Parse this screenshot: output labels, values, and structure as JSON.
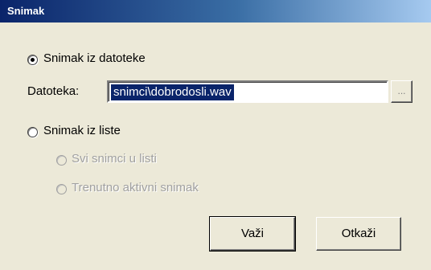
{
  "window": {
    "title": "Snimak"
  },
  "options": {
    "from_file": {
      "label": "Snimak iz datoteke",
      "selected": true
    },
    "from_list": {
      "label": "Snimak iz liste",
      "selected": false
    },
    "all_in_list": {
      "label": "Svi snimci u listi",
      "enabled": false
    },
    "currently_active": {
      "label": "Trenutno aktivni snimak",
      "enabled": false
    }
  },
  "file": {
    "label": "Datoteka:",
    "value": "snimci\\dobrodosli.wav",
    "browse_label": "..."
  },
  "buttons": {
    "ok": "Važi",
    "cancel": "Otkaži"
  }
}
